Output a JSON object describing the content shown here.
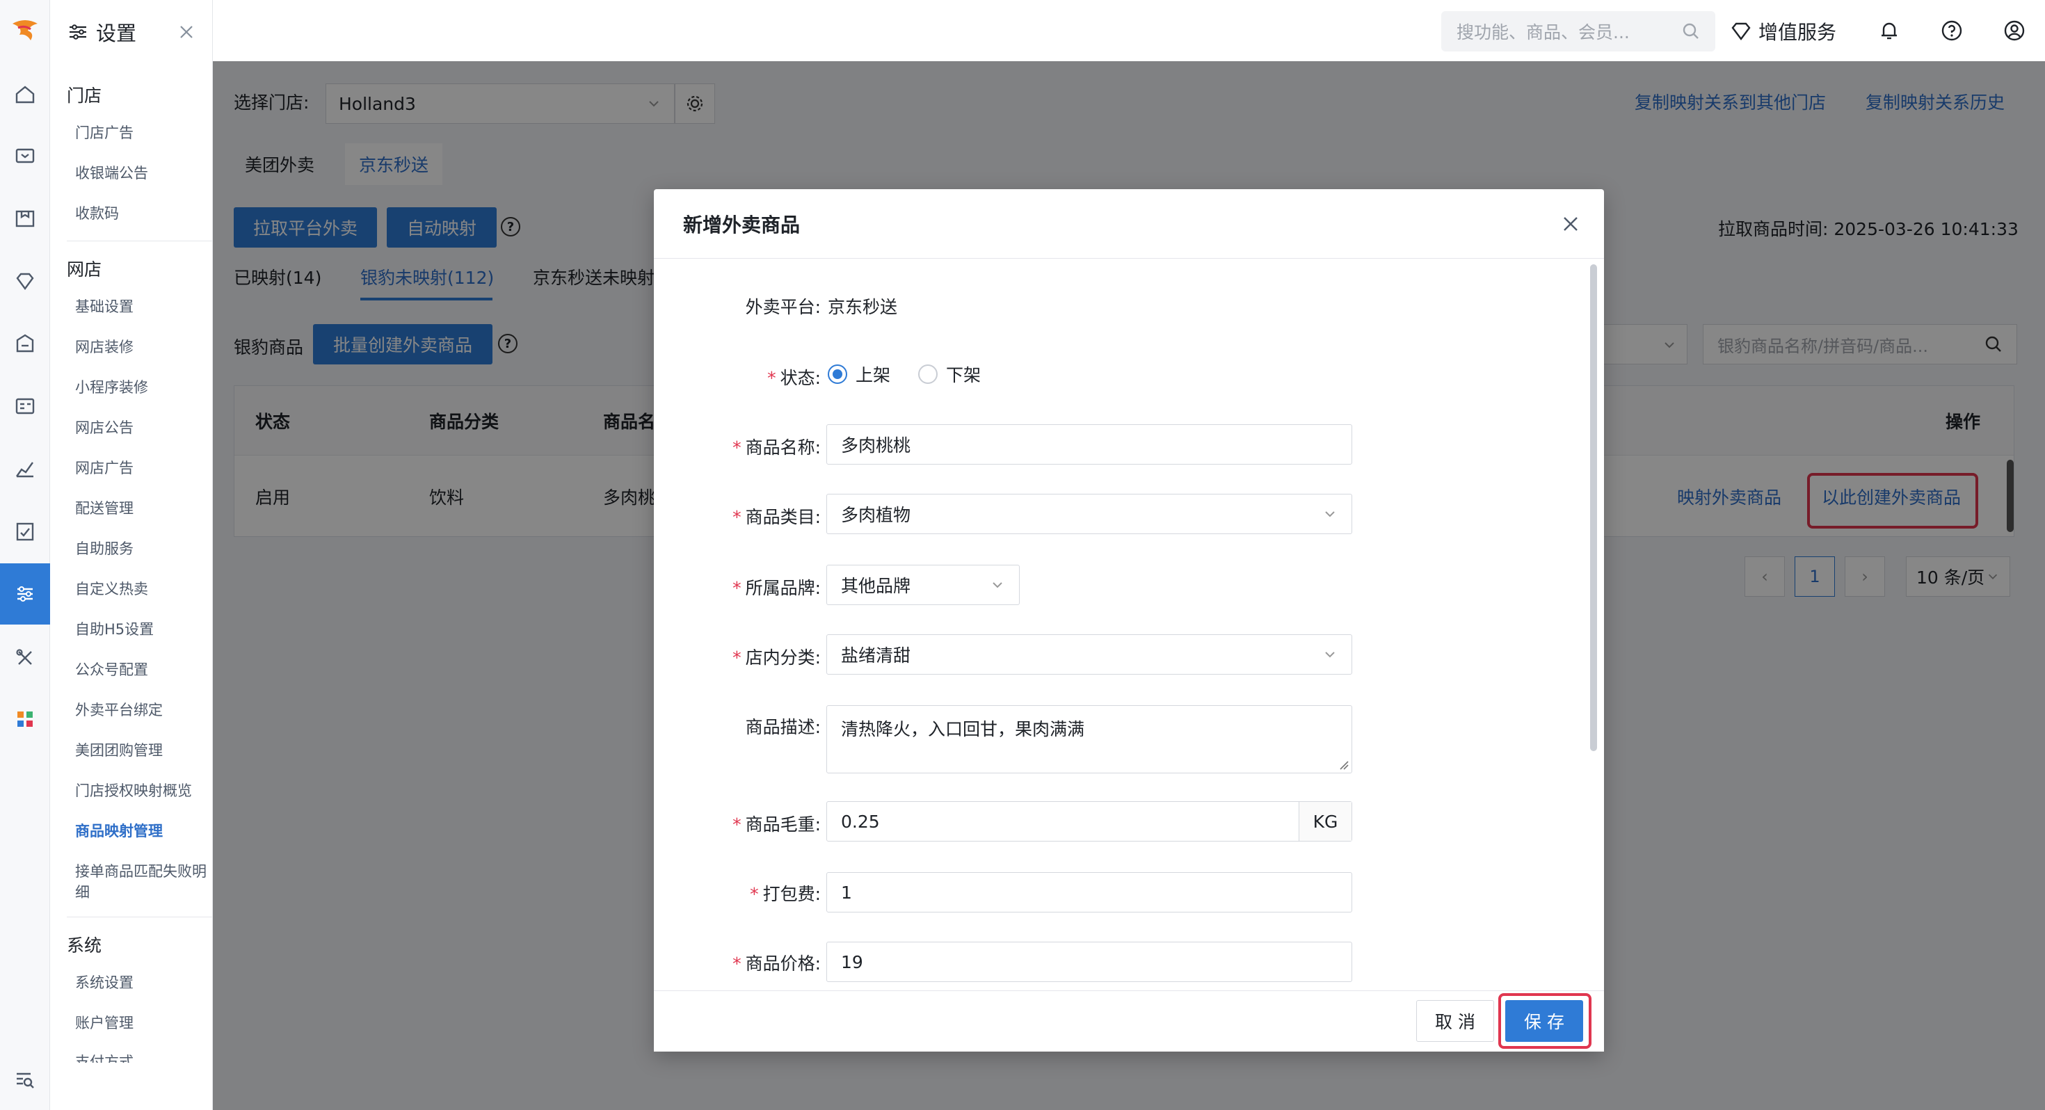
{
  "sidebar": {
    "title": "设置",
    "groups": [
      {
        "label": "门店",
        "items": [
          "门店广告",
          "收银端公告",
          "收款码"
        ]
      },
      {
        "label": "网店",
        "items": [
          "基础设置",
          "网店装修",
          "小程序装修",
          "网店公告",
          "网店广告",
          "配送管理",
          "自助服务",
          "自定义热卖",
          "自助H5设置",
          "公众号配置",
          "外卖平台绑定",
          "美团团购管理",
          "门店授权映射概览",
          "商品映射管理",
          "接单商品匹配失败明细"
        ]
      },
      {
        "label": "系统",
        "items": [
          "系统设置",
          "账户管理",
          "支付方式"
        ]
      }
    ],
    "active_item": "商品映射管理"
  },
  "topbar": {
    "search_placeholder": "搜功能、商品、会员...",
    "vip_label": "增值服务"
  },
  "page": {
    "store_label": "选择门店:",
    "store_value": "Holland3",
    "copy_link": "复制映射关系到其他门店",
    "history_link": "复制映射关系历史",
    "platform_tabs": [
      "美团外卖",
      "京东秒送"
    ],
    "active_platform": "京东秒送",
    "pull_button": "拉取平台外卖",
    "auto_map_button": "自动映射",
    "pull_time": "拉取商品时间: 2025-03-26 10:41:33",
    "sub_tabs": [
      "已映射(14)",
      "银豹未映射(112)",
      "京东秒送未映射"
    ],
    "yinbao_label": "银豹商品",
    "batch_create_button": "批量创建外卖商品",
    "search_placeholder": "银豹商品名称/拼音码/商品...",
    "table": {
      "headers": [
        "状态",
        "商品分类",
        "商品名",
        "操作"
      ],
      "row": {
        "status": "启用",
        "category": "饮料",
        "name": "多肉桃",
        "action_map": "映射外卖商品",
        "action_create": "以此创建外卖商品"
      }
    },
    "pagination": {
      "current": "1",
      "page_size": "10 条/页"
    }
  },
  "modal": {
    "title": "新增外卖商品",
    "platform_label": "外卖平台:",
    "platform_value": "京东秒送",
    "status_label": "状态:",
    "status_options": [
      "上架",
      "下架"
    ],
    "status_selected": "上架",
    "name_label": "商品名称:",
    "name_value": "多肉桃桃",
    "category_label": "商品类目:",
    "category_value": "多肉植物",
    "brand_label": "所属品牌:",
    "brand_value": "其他品牌",
    "store_cat_label": "店内分类:",
    "store_cat_value": "盐绪清甜",
    "desc_label": "商品描述:",
    "desc_value": "清热降火，入口回甘，果肉满满",
    "weight_label": "商品毛重:",
    "weight_value": "0.25",
    "weight_unit": "KG",
    "pack_label": "打包费:",
    "pack_value": "1",
    "price_label": "商品价格:",
    "price_value": "19",
    "cancel_button": "取 消",
    "save_button": "保 存"
  },
  "colors": {
    "accent": "#2f7bd6",
    "highlight": "#e0364f"
  }
}
